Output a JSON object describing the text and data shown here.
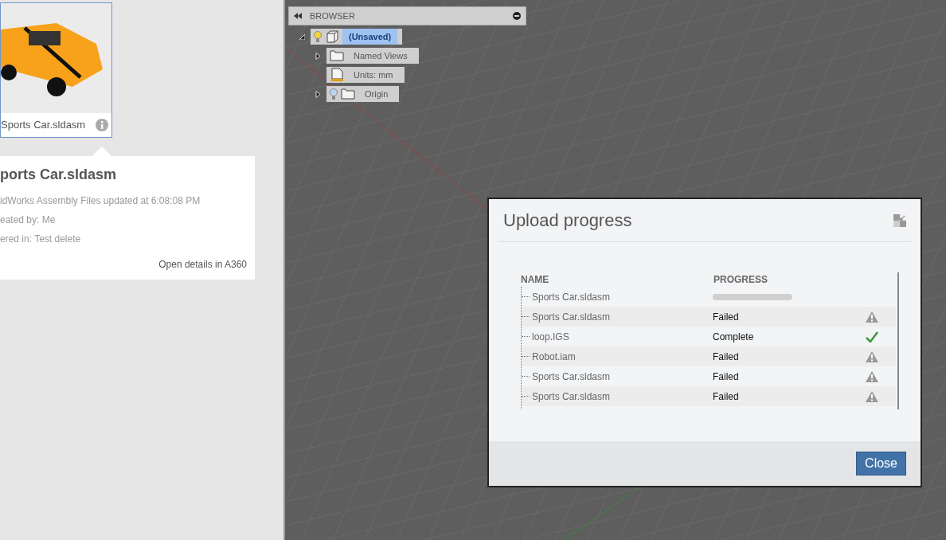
{
  "thumbnail": {
    "caption": "Sports Car.sldasm"
  },
  "popover": {
    "title": "ports Car.sldasm",
    "lines": [
      "idWorks Assembly Files updated at 6:08:08 PM",
      "eated by: Me",
      "ered in: Test delete"
    ],
    "link": "Open details in A360"
  },
  "browser": {
    "title": "BROWSER",
    "tree": [
      {
        "label": "(Unsaved)",
        "kind": "component",
        "bulb": true,
        "expanded": true,
        "selected": true,
        "children": [
          {
            "label": "Named Views",
            "kind": "folder",
            "bulb": false,
            "expanded": false,
            "selected": false
          },
          {
            "label": "Units: mm",
            "kind": "document",
            "bulb": false,
            "selected": false
          },
          {
            "label": "Origin",
            "kind": "folder",
            "bulb": true,
            "expanded": false,
            "selected": false
          }
        ]
      }
    ]
  },
  "dialog": {
    "title": "Upload progress",
    "columns": [
      "NAME",
      "PROGRESS"
    ],
    "rows": [
      {
        "name": "Sports Car.sldasm",
        "kind": "uploading",
        "level": 0
      },
      {
        "name": "Sports Car.sldasm",
        "kind": "failed",
        "status": "Failed"
      },
      {
        "name": "loop.IGS",
        "kind": "complete",
        "status": "Complete"
      },
      {
        "name": "Robot.iam",
        "kind": "failed",
        "status": "Failed"
      },
      {
        "name": "Sports Car.sldasm",
        "kind": "failed",
        "status": "Failed"
      },
      {
        "name": "Sports Car.sldasm",
        "kind": "failed",
        "status": "Failed"
      }
    ],
    "buttons": [
      "Close"
    ]
  }
}
